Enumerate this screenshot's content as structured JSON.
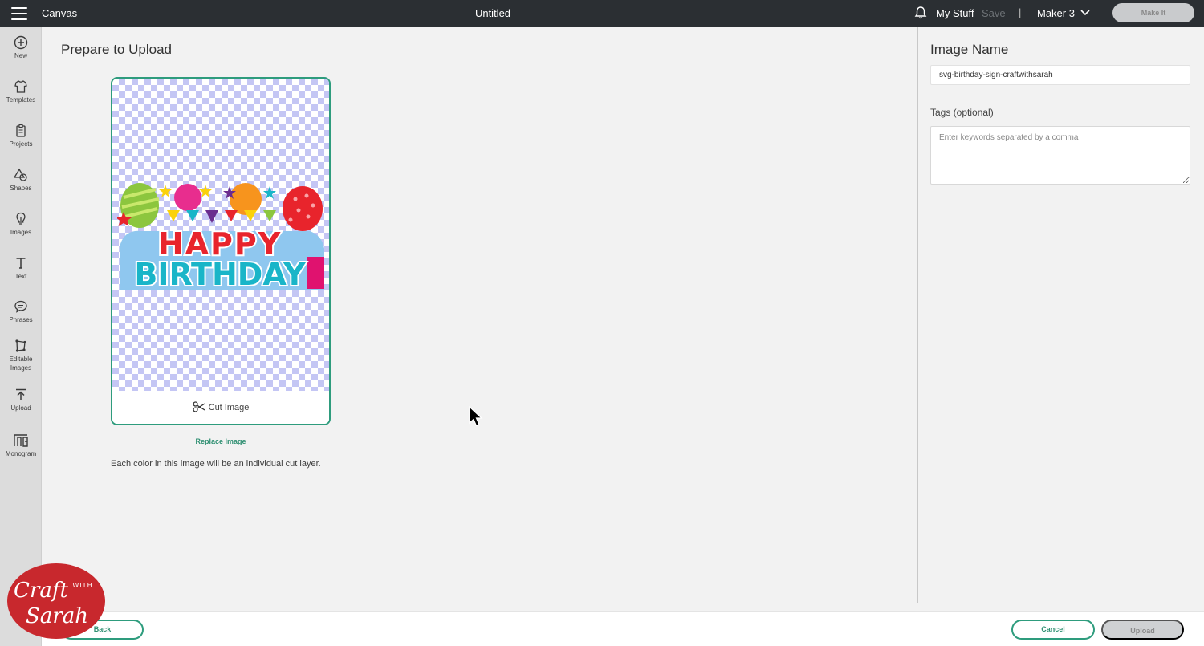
{
  "topbar": {
    "app_title": "Canvas",
    "doc_title": "Untitled",
    "my_stuff": "My Stuff",
    "save": "Save",
    "separator": "|",
    "machine": "Maker 3",
    "make_it": "Make It"
  },
  "sidebar": {
    "items": [
      {
        "label": "New",
        "icon": "plus-circle-icon"
      },
      {
        "label": "Templates",
        "icon": "shirt-icon"
      },
      {
        "label": "Projects",
        "icon": "clipboard-icon"
      },
      {
        "label": "Shapes",
        "icon": "shapes-icon"
      },
      {
        "label": "Images",
        "icon": "lightbulb-icon"
      },
      {
        "label": "Text",
        "icon": "text-t-icon"
      },
      {
        "label": "Phrases",
        "icon": "speech-bubble-icon"
      },
      {
        "label": "Editable Images",
        "icon": "editable-image-icon"
      },
      {
        "label": "Upload",
        "icon": "upload-icon"
      },
      {
        "label": "Monogram",
        "icon": "monogram-icon"
      }
    ]
  },
  "main": {
    "title": "Prepare to Upload",
    "cut_label": "Cut Image",
    "replace": "Replace Image",
    "note": "Each color in this image will be an individual cut layer.",
    "artwork": {
      "line1": "HAPPY",
      "line2": "BIRTHDAY"
    }
  },
  "panel": {
    "title": "Image Name",
    "name_value": "svg-birthday-sign-craftwithsarah",
    "tags_label": "Tags (optional)",
    "tags_placeholder": "Enter keywords separated by a comma"
  },
  "footer": {
    "back": "Back",
    "cancel": "Cancel",
    "upload": "Upload"
  },
  "watermark": {
    "craft": "Craft",
    "with": "WITH",
    "sarah": "Sarah"
  },
  "colors": {
    "accent": "#2e9c7d",
    "topbar": "#2b2f33",
    "checker": "#c4c6f4"
  }
}
